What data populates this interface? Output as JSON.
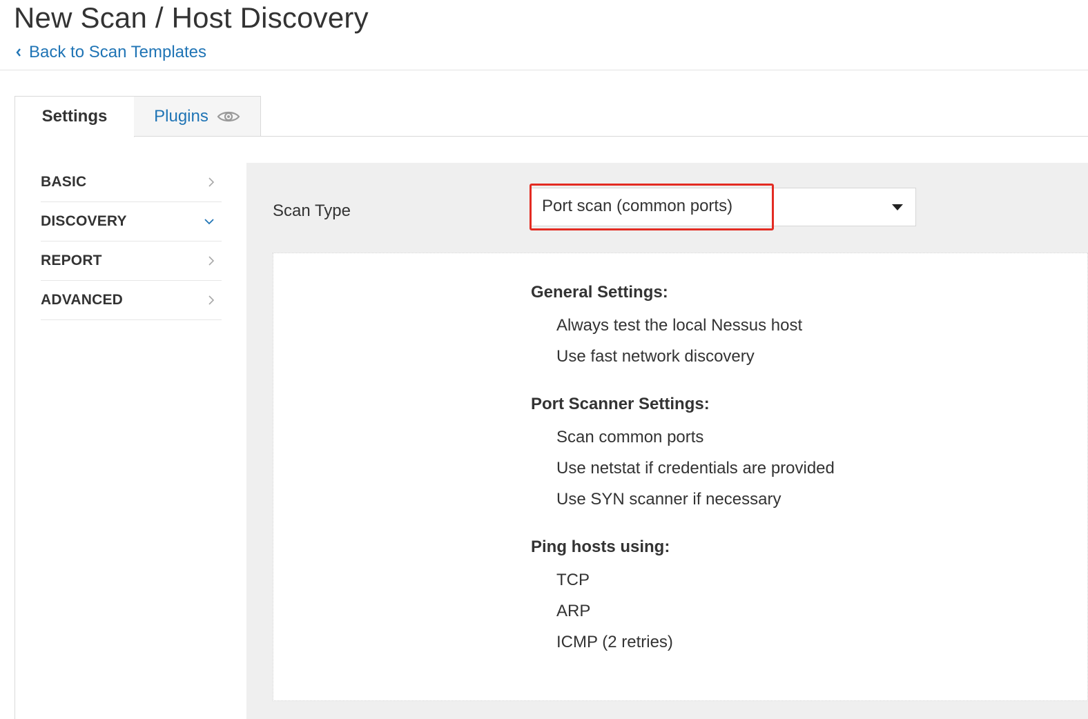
{
  "header": {
    "title": "New Scan / Host Discovery",
    "back_link": "Back to Scan Templates"
  },
  "tabs": [
    {
      "label": "Settings",
      "active": true
    },
    {
      "label": "Plugins",
      "active": false,
      "icon": "eye-icon"
    }
  ],
  "sidebar": {
    "items": [
      {
        "label": "BASIC",
        "icon": "chevron-right-icon",
        "expanded": false
      },
      {
        "label": "DISCOVERY",
        "icon": "chevron-down-icon",
        "expanded": true
      },
      {
        "label": "REPORT",
        "icon": "chevron-right-icon",
        "expanded": false
      },
      {
        "label": "ADVANCED",
        "icon": "chevron-right-icon",
        "expanded": false
      }
    ]
  },
  "main": {
    "scan_type_label": "Scan Type",
    "scan_type_value": "Port scan (common ports)",
    "sections": [
      {
        "heading": "General Settings:",
        "items": [
          "Always test the local Nessus host",
          "Use fast network discovery"
        ]
      },
      {
        "heading": "Port Scanner Settings:",
        "items": [
          "Scan common ports",
          "Use netstat if credentials are provided",
          "Use SYN scanner if necessary"
        ]
      },
      {
        "heading": "Ping hosts using:",
        "items": [
          "TCP",
          "ARP",
          "ICMP (2 retries)"
        ]
      }
    ]
  },
  "colors": {
    "link": "#1f74b5",
    "highlight": "#e32b22",
    "panel_bg": "#efefef"
  }
}
